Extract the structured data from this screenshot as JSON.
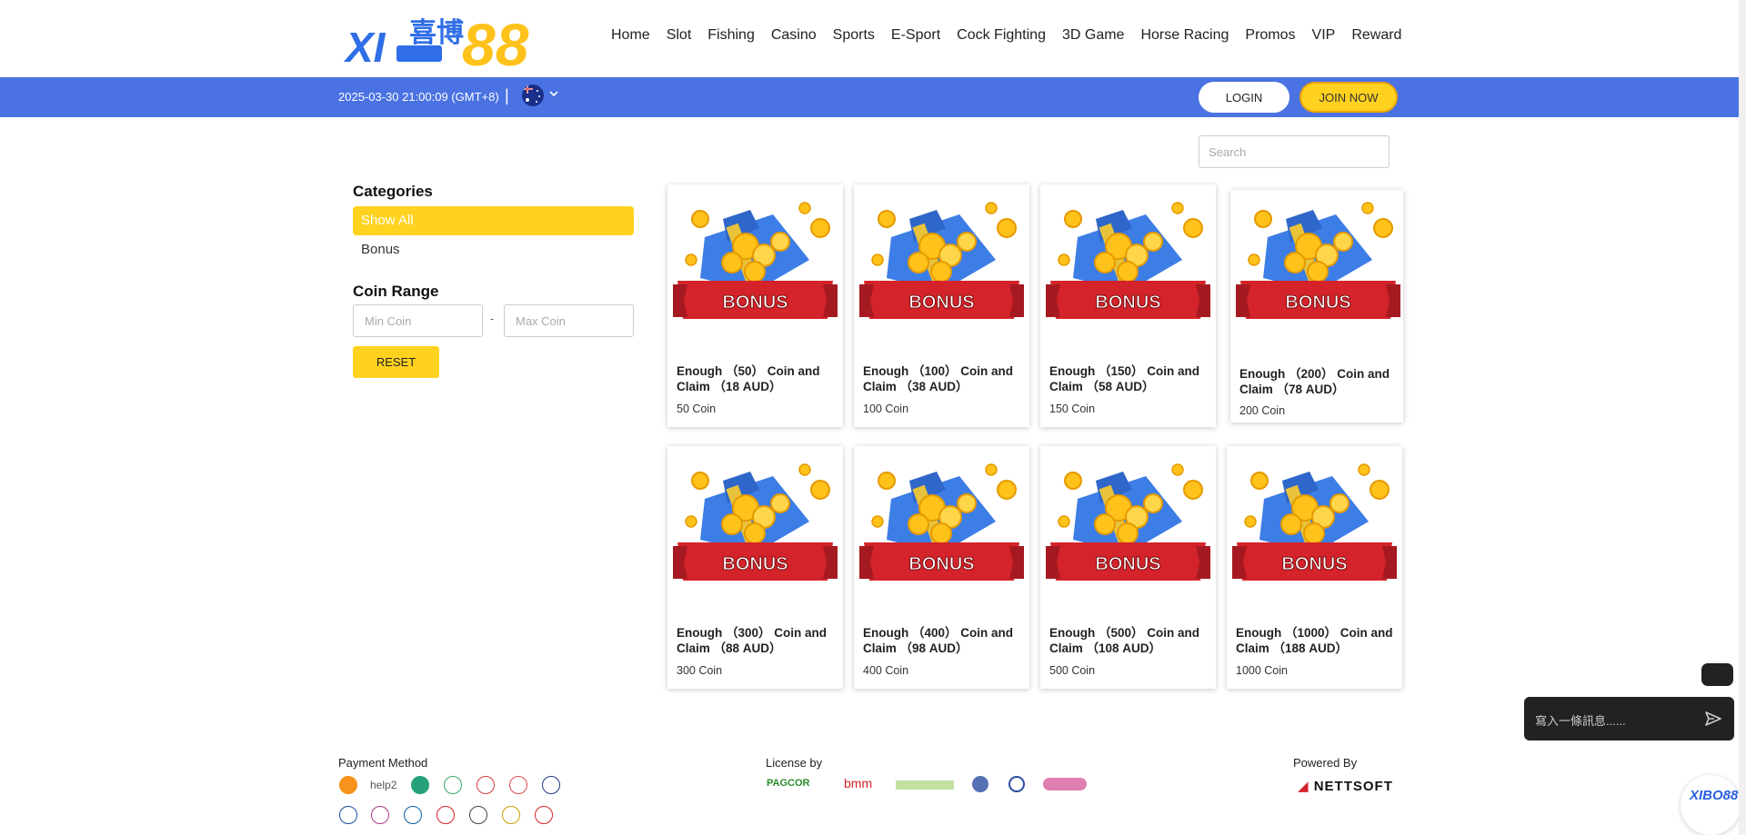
{
  "header": {
    "logo_text": "XIBO88",
    "logo_chinese": "喜博",
    "nav": [
      "Home",
      "Slot",
      "Fishing",
      "Casino",
      "Sports",
      "E-Sport",
      "Cock Fighting",
      "3D Game",
      "Horse Racing",
      "Promos",
      "VIP",
      "Reward"
    ]
  },
  "topbar": {
    "datetime": "2025-03-30 21:00:09 (GMT+8)",
    "separator": "|",
    "login_label": "LOGIN",
    "join_label": "JOIN NOW",
    "flag_icon": "australia-flag-icon"
  },
  "search": {
    "placeholder": "Search"
  },
  "sidebar": {
    "categories_title": "Categories",
    "categories": [
      "Show All",
      "Bonus"
    ],
    "coin_range_title": "Coin Range",
    "min_placeholder": "Min Coin",
    "max_placeholder": "Max Coin",
    "dash": "-",
    "reset_label": "RESET"
  },
  "products": [
    {
      "title": "Enough （50） Coin and Claim （18 AUD）",
      "coin": "50 Coin",
      "badge": "BONUS"
    },
    {
      "title": "Enough （100） Coin and Claim （38 AUD）",
      "coin": "100 Coin",
      "badge": "BONUS"
    },
    {
      "title": "Enough （150） Coin and Claim （58 AUD）",
      "coin": "150 Coin",
      "badge": "BONUS"
    },
    {
      "title": "Enough （200） Coin and Claim （78 AUD）",
      "coin": "200 Coin",
      "badge": "BONUS"
    },
    {
      "title": "Enough （300） Coin and Claim （88 AUD）",
      "coin": "300 Coin",
      "badge": "BONUS"
    },
    {
      "title": "Enough （400） Coin and Claim （98 AUD）",
      "coin": "400 Coin",
      "badge": "BONUS"
    },
    {
      "title": "Enough （500） Coin and Claim （108 AUD）",
      "coin": "500 Coin",
      "badge": "BONUS"
    },
    {
      "title": "Enough （1000） Coin and Claim （188 AUD）",
      "coin": "1000 Coin",
      "badge": "BONUS"
    }
  ],
  "chat": {
    "placeholder": "寫入一條訊息......"
  },
  "footer": {
    "payment_title": "Payment Method",
    "license_title": "License by",
    "powered_title": "Powered By",
    "license_logos": [
      "PAGCOR",
      "bmm"
    ],
    "powered_by": "NETTSOFT",
    "corner_logo": "XIBO88"
  },
  "colors": {
    "accent": "#ffd21f",
    "bar": "#4a72e2",
    "ribbon": "#d4232a"
  }
}
